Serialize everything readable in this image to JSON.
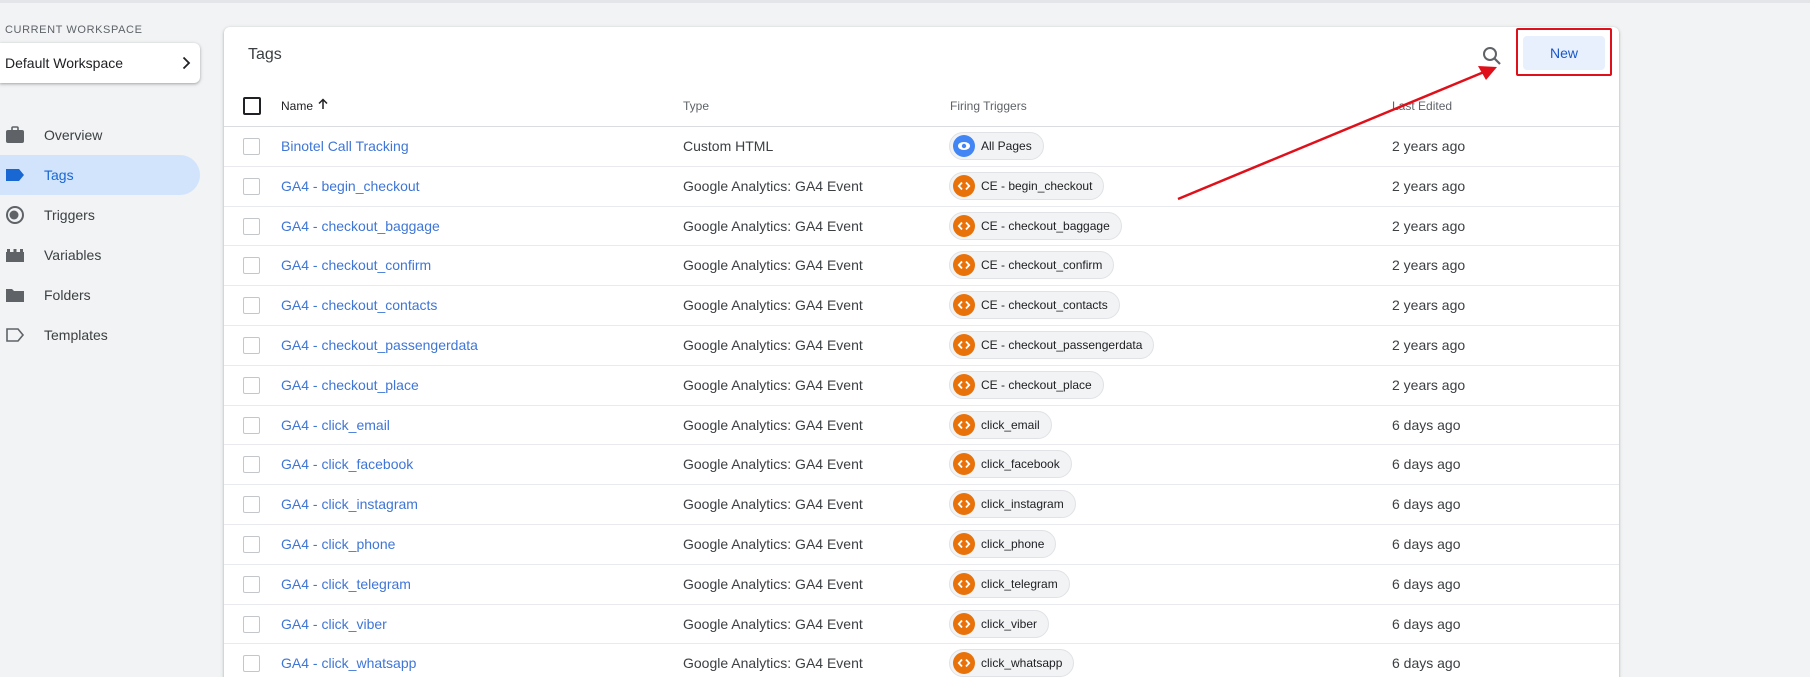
{
  "workspace": {
    "label": "CURRENT WORKSPACE",
    "name": "Default Workspace"
  },
  "nav": [
    {
      "label": "Overview",
      "icon": "briefcase-icon",
      "active": false
    },
    {
      "label": "Tags",
      "icon": "tag-icon",
      "active": true
    },
    {
      "label": "Triggers",
      "icon": "trigger-icon",
      "active": false
    },
    {
      "label": "Variables",
      "icon": "variables-icon",
      "active": false
    },
    {
      "label": "Folders",
      "icon": "folder-icon",
      "active": false
    },
    {
      "label": "Templates",
      "icon": "template-icon",
      "active": false
    }
  ],
  "panel": {
    "title": "Tags",
    "new_label": "New",
    "search_icon": "search-icon"
  },
  "columns": {
    "name": "Name",
    "type": "Type",
    "triggers": "Firing Triggers",
    "edited": "Last Edited"
  },
  "colors": {
    "accent": "#1a73e8",
    "link": "#3f76d6",
    "custom_event_chip": "#e8710a",
    "pageview_chip": "#4285f4",
    "highlight": "#e0101a"
  },
  "rows": [
    {
      "name": "Binotel Call Tracking",
      "type": "Custom HTML",
      "trigger": "All Pages",
      "trigger_kind": "pageview",
      "edited": "2 years ago"
    },
    {
      "name": "GA4 - begin_checkout",
      "type": "Google Analytics: GA4 Event",
      "trigger": "CE - begin_checkout",
      "trigger_kind": "custom",
      "edited": "2 years ago"
    },
    {
      "name": "GA4 - checkout_baggage",
      "type": "Google Analytics: GA4 Event",
      "trigger": "CE - checkout_baggage",
      "trigger_kind": "custom",
      "edited": "2 years ago"
    },
    {
      "name": "GA4 - checkout_confirm",
      "type": "Google Analytics: GA4 Event",
      "trigger": "CE - checkout_confirm",
      "trigger_kind": "custom",
      "edited": "2 years ago"
    },
    {
      "name": "GA4 - checkout_contacts",
      "type": "Google Analytics: GA4 Event",
      "trigger": "CE - checkout_contacts",
      "trigger_kind": "custom",
      "edited": "2 years ago"
    },
    {
      "name": "GA4 - checkout_passengerdata",
      "type": "Google Analytics: GA4 Event",
      "trigger": "CE - checkout_passengerdata",
      "trigger_kind": "custom",
      "edited": "2 years ago"
    },
    {
      "name": "GA4 - checkout_place",
      "type": "Google Analytics: GA4 Event",
      "trigger": "CE - checkout_place",
      "trigger_kind": "custom",
      "edited": "2 years ago"
    },
    {
      "name": "GA4 - click_email",
      "type": "Google Analytics: GA4 Event",
      "trigger": "click_email",
      "trigger_kind": "custom",
      "edited": "6 days ago"
    },
    {
      "name": "GA4 - click_facebook",
      "type": "Google Analytics: GA4 Event",
      "trigger": "click_facebook",
      "trigger_kind": "custom",
      "edited": "6 days ago"
    },
    {
      "name": "GA4 - click_instagram",
      "type": "Google Analytics: GA4 Event",
      "trigger": "click_instagram",
      "trigger_kind": "custom",
      "edited": "6 days ago"
    },
    {
      "name": "GA4 - click_phone",
      "type": "Google Analytics: GA4 Event",
      "trigger": "click_phone",
      "trigger_kind": "custom",
      "edited": "6 days ago"
    },
    {
      "name": "GA4 - click_telegram",
      "type": "Google Analytics: GA4 Event",
      "trigger": "click_telegram",
      "trigger_kind": "custom",
      "edited": "6 days ago"
    },
    {
      "name": "GA4 - click_viber",
      "type": "Google Analytics: GA4 Event",
      "trigger": "click_viber",
      "trigger_kind": "custom",
      "edited": "6 days ago"
    },
    {
      "name": "GA4 - click_whatsapp",
      "type": "Google Analytics: GA4 Event",
      "trigger": "click_whatsapp",
      "trigger_kind": "custom",
      "edited": "6 days ago"
    }
  ]
}
